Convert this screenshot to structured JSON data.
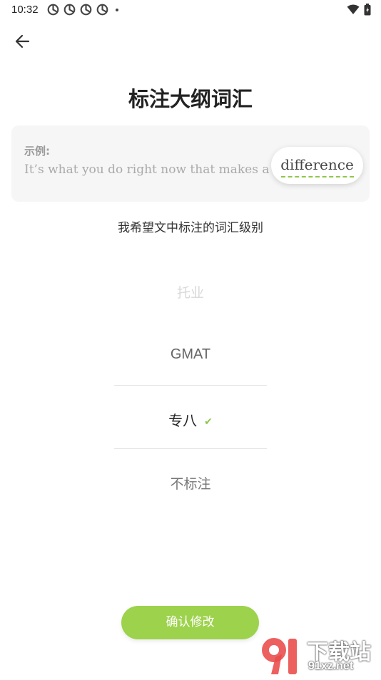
{
  "status_bar": {
    "time": "10:32"
  },
  "header": {
    "title": "标注大纲词汇"
  },
  "example": {
    "label": "示例:",
    "sentence": "It’s what you do right now that makes a",
    "highlight_word": "difference"
  },
  "prompt": "我希望文中标注的词汇级别",
  "picker": {
    "items": [
      "托业",
      "GMAT",
      "专八",
      "不标注"
    ],
    "selected": "专八"
  },
  "confirm_label": "确认修改",
  "watermark": {
    "text": "下载站",
    "url": "91xz.net",
    "logo_digits": "91"
  },
  "colors": {
    "accent": "#9dd24c",
    "highlight_dash": "#8fc74a"
  }
}
